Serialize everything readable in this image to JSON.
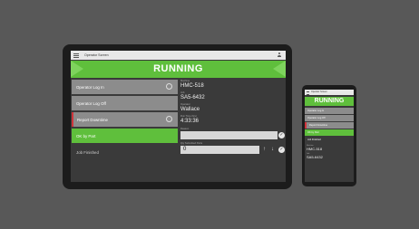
{
  "app": {
    "title": "Operator Screen",
    "status": "RUNNING"
  },
  "menu": {
    "items": [
      {
        "label": "Operator Log In"
      },
      {
        "label": "Operator Log Off"
      },
      {
        "label": "Report Downtime"
      },
      {
        "label": "OK by Part"
      },
      {
        "label": "Job Finished"
      }
    ]
  },
  "details": {
    "fields": [
      {
        "label": "Machine",
        "value": "HMC-518"
      },
      {
        "label": "Job",
        "value": "SA5-6432"
      },
      {
        "label": "Operator",
        "value": "Wallace"
      },
      {
        "label": "Run Time (hrs)",
        "value": "4:33:36"
      }
    ],
    "reason": {
      "label": "Reason",
      "value": ""
    },
    "qty": {
      "label": "Qty Submitted Parts",
      "value": "0"
    }
  },
  "phone": {
    "title": "Operator Screen",
    "status": "RUNNING",
    "items": [
      {
        "label": "Operator Log In"
      },
      {
        "label": "Operator Log Off"
      },
      {
        "label": "Report Downtime"
      },
      {
        "label": "OK by Part"
      },
      {
        "label": "Job Finished"
      }
    ],
    "fields": [
      {
        "label": "Machine",
        "value": "HMC-518"
      },
      {
        "label": "Job",
        "value": "SA5-6432"
      }
    ]
  },
  "icons": {
    "menu": "hamburger-menu-icon",
    "user": "user-icon",
    "confirm": "check-circle-icon",
    "up": "arrow-up-icon",
    "down": "arrow-down-icon"
  },
  "colors": {
    "running": "#5fbf3c",
    "downtime": "#d0333a",
    "button": "#8c8c8c",
    "background": "#585858"
  }
}
